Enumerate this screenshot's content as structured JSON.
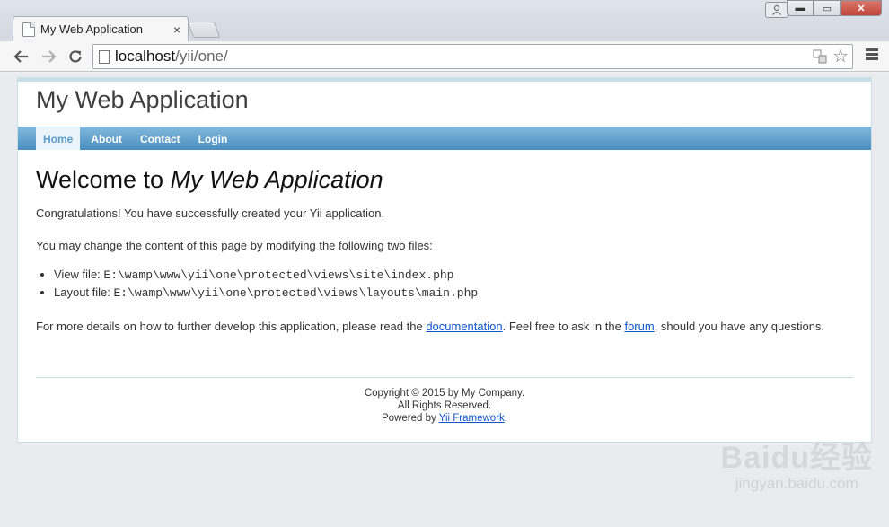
{
  "browser": {
    "tab_title": "My Web Application",
    "tab_close": "×",
    "url_host": "localhost",
    "url_path": "/yii/one/",
    "window_controls": {
      "minimize": "▬",
      "maximize": "▭",
      "close": "✕"
    },
    "icons": [
      "user-icon",
      "back-icon",
      "forward-icon",
      "reload-icon",
      "page-icon",
      "translate-icon",
      "star-icon",
      "menu-icon"
    ]
  },
  "site": {
    "name": "My Web Application",
    "menu": [
      {
        "label": "Home",
        "active": true
      },
      {
        "label": "About",
        "active": false
      },
      {
        "label": "Contact",
        "active": false
      },
      {
        "label": "Login",
        "active": false
      }
    ],
    "welcome_prefix": "Welcome to ",
    "welcome_name": "My Web Application",
    "congrats": "Congratulations! You have successfully created your Yii application.",
    "change_intro": "You may change the content of this page by modifying the following two files:",
    "files": [
      {
        "label": "View file: ",
        "path": "E:\\wamp\\www\\yii\\one\\protected\\views\\site\\index.php"
      },
      {
        "label": "Layout file: ",
        "path": "E:\\wamp\\www\\yii\\one\\protected\\views\\layouts\\main.php"
      }
    ],
    "details_prefix": "For more details on how to further develop this application, please read the ",
    "documentation_link": "documentation",
    "details_middle": ". Feel free to ask in the ",
    "forum_link": "forum",
    "details_suffix": ", should you have any questions.",
    "footer": {
      "copyright": "Copyright © 2015 by My Company.",
      "rights": "All Rights Reserved.",
      "powered_prefix": "Powered by ",
      "framework_link": "Yii Framework",
      "powered_suffix": "."
    }
  },
  "watermark": {
    "brand": "Baidu经验",
    "domain": "jingyan.baidu.com"
  }
}
